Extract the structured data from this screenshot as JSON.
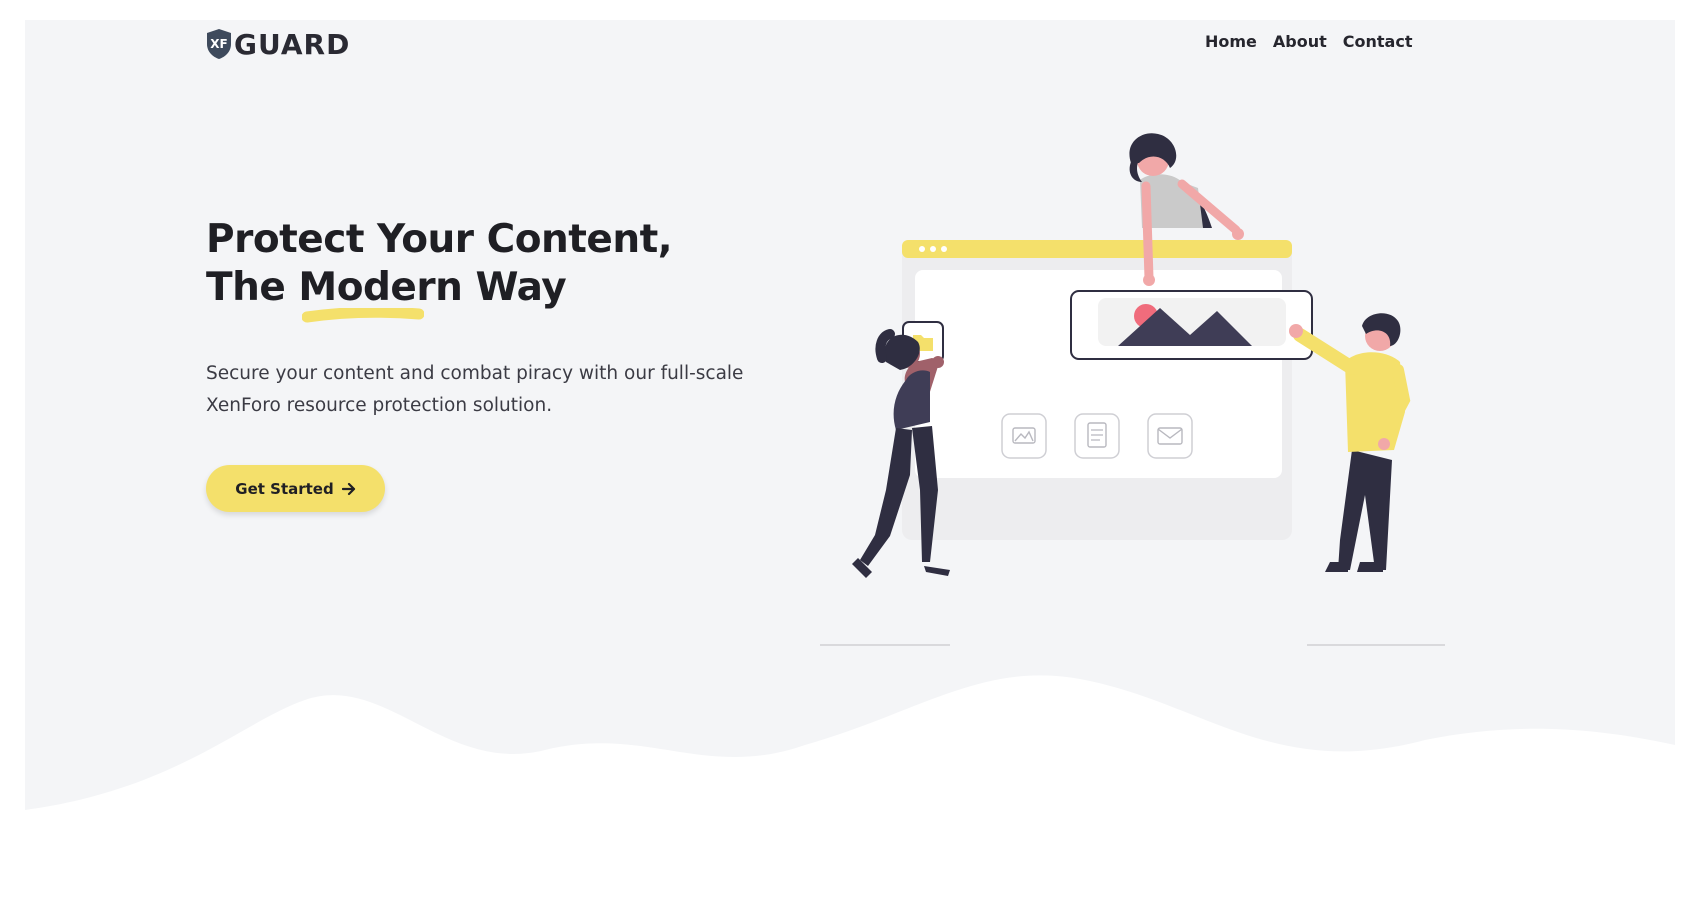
{
  "brand": {
    "badge": "XF",
    "name": "GUARD",
    "logo_icon": "shield-icon"
  },
  "nav": {
    "items": [
      "Home",
      "About",
      "Contact"
    ]
  },
  "hero": {
    "title_line1": "Protect Your Content,",
    "title_line2_before": "The ",
    "title_highlight": "Modern",
    "title_line2_after": " Way",
    "subtitle": "Secure your content and combat piracy with our full-scale XenForo resource protection solution.",
    "cta_label": "Get Started",
    "cta_icon": "arrow-right-icon"
  },
  "colors": {
    "accent": "#f4e06b",
    "background": "#f4f5f7",
    "dark": "#2f2e41",
    "text": "#1f1f24",
    "pink": "#f1a8a8",
    "red": "#f06c7c"
  },
  "illustration": {
    "icons": [
      "folder-icon",
      "image-icon",
      "document-icon",
      "mail-icon"
    ]
  }
}
